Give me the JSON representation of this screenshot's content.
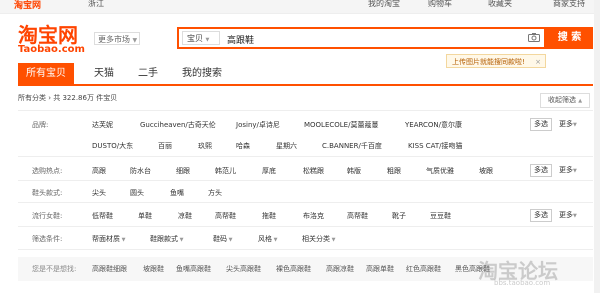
{
  "top_bar": {
    "brand": "淘宝网",
    "location": "浙江",
    "links": [
      "我的淘宝",
      "购物车",
      "收藏夹",
      "商家支持"
    ]
  },
  "logo": {
    "main": "淘宝网",
    "sub": "Taobao.com"
  },
  "more_market": "更多市场",
  "search": {
    "category": "宝贝",
    "value": "高跟鞋",
    "button": "搜 索"
  },
  "tooltip": {
    "text": "上传图片就能搜同款啦!",
    "close": "×"
  },
  "tabs": [
    "所有宝贝",
    "天猫",
    "二手",
    "我的搜索"
  ],
  "breadcrumb": {
    "text": "所有分类 › 共 322.86万 件宝贝",
    "collapse": "收起筛选"
  },
  "filters": {
    "brand": {
      "label": "品牌:",
      "row1": [
        "达芙妮",
        "Gucciheaven/古奇天伦",
        "Josiny/卓诗尼",
        "MOOLECOLE/莫蕾蔻蔓",
        "YEARCON/意尔康"
      ],
      "row2": [
        "DUSTO/大东",
        "百丽",
        "玖熙",
        "哈森",
        "星期六",
        "C.BANNER/千百度",
        "KISS CAT/接吻猫"
      ],
      "multi": "多选",
      "more": "更多"
    },
    "hot": {
      "label": "选购热点:",
      "items": [
        "高跟",
        "防水台",
        "细跟",
        "韩范儿",
        "厚底",
        "松糕跟",
        "韩版",
        "粗跟",
        "气质优雅",
        "坡跟"
      ],
      "multi": "多选",
      "more": "更多"
    },
    "toe": {
      "label": "鞋头款式:",
      "items": [
        "尖头",
        "圆头",
        "鱼嘴",
        "方头"
      ]
    },
    "popular": {
      "label": "流行女鞋:",
      "items": [
        "低帮鞋",
        "单鞋",
        "凉鞋",
        "高帮鞋",
        "拖鞋",
        "布洛克",
        "高帮鞋",
        "靴子",
        "豆豆鞋"
      ],
      "multi": "多选",
      "more": "更多"
    },
    "conditions": {
      "label": "筛选条件:",
      "items": [
        "帮面材质",
        "鞋跟款式",
        "鞋码",
        "风格",
        "相关分类"
      ]
    }
  },
  "related": {
    "label": "您是不是想找:",
    "items": [
      "高跟鞋细跟",
      "坡跟鞋",
      "鱼嘴高跟鞋",
      "尖头高跟鞋",
      "裸色高跟鞋",
      "高跟凉鞋",
      "高跟单鞋",
      "红色高跟鞋",
      "黑色高跟鞋"
    ]
  },
  "watermark": {
    "main": "淘宝论坛",
    "sub": "bbs.taobao.com"
  },
  "colors": {
    "accent": "#ff5000",
    "logo": "#ff4400"
  }
}
